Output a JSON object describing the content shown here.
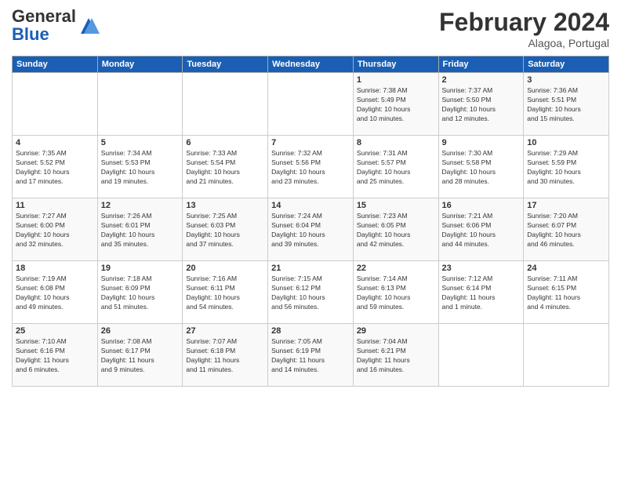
{
  "header": {
    "logo_text_general": "General",
    "logo_text_blue": "Blue",
    "title": "February 2024",
    "subtitle": "Alagoa, Portugal"
  },
  "days_of_week": [
    "Sunday",
    "Monday",
    "Tuesday",
    "Wednesday",
    "Thursday",
    "Friday",
    "Saturday"
  ],
  "weeks": [
    [
      {
        "day": "",
        "info": ""
      },
      {
        "day": "",
        "info": ""
      },
      {
        "day": "",
        "info": ""
      },
      {
        "day": "",
        "info": ""
      },
      {
        "day": "1",
        "info": "Sunrise: 7:38 AM\nSunset: 5:49 PM\nDaylight: 10 hours\nand 10 minutes."
      },
      {
        "day": "2",
        "info": "Sunrise: 7:37 AM\nSunset: 5:50 PM\nDaylight: 10 hours\nand 12 minutes."
      },
      {
        "day": "3",
        "info": "Sunrise: 7:36 AM\nSunset: 5:51 PM\nDaylight: 10 hours\nand 15 minutes."
      }
    ],
    [
      {
        "day": "4",
        "info": "Sunrise: 7:35 AM\nSunset: 5:52 PM\nDaylight: 10 hours\nand 17 minutes."
      },
      {
        "day": "5",
        "info": "Sunrise: 7:34 AM\nSunset: 5:53 PM\nDaylight: 10 hours\nand 19 minutes."
      },
      {
        "day": "6",
        "info": "Sunrise: 7:33 AM\nSunset: 5:54 PM\nDaylight: 10 hours\nand 21 minutes."
      },
      {
        "day": "7",
        "info": "Sunrise: 7:32 AM\nSunset: 5:56 PM\nDaylight: 10 hours\nand 23 minutes."
      },
      {
        "day": "8",
        "info": "Sunrise: 7:31 AM\nSunset: 5:57 PM\nDaylight: 10 hours\nand 25 minutes."
      },
      {
        "day": "9",
        "info": "Sunrise: 7:30 AM\nSunset: 5:58 PM\nDaylight: 10 hours\nand 28 minutes."
      },
      {
        "day": "10",
        "info": "Sunrise: 7:29 AM\nSunset: 5:59 PM\nDaylight: 10 hours\nand 30 minutes."
      }
    ],
    [
      {
        "day": "11",
        "info": "Sunrise: 7:27 AM\nSunset: 6:00 PM\nDaylight: 10 hours\nand 32 minutes."
      },
      {
        "day": "12",
        "info": "Sunrise: 7:26 AM\nSunset: 6:01 PM\nDaylight: 10 hours\nand 35 minutes."
      },
      {
        "day": "13",
        "info": "Sunrise: 7:25 AM\nSunset: 6:03 PM\nDaylight: 10 hours\nand 37 minutes."
      },
      {
        "day": "14",
        "info": "Sunrise: 7:24 AM\nSunset: 6:04 PM\nDaylight: 10 hours\nand 39 minutes."
      },
      {
        "day": "15",
        "info": "Sunrise: 7:23 AM\nSunset: 6:05 PM\nDaylight: 10 hours\nand 42 minutes."
      },
      {
        "day": "16",
        "info": "Sunrise: 7:21 AM\nSunset: 6:06 PM\nDaylight: 10 hours\nand 44 minutes."
      },
      {
        "day": "17",
        "info": "Sunrise: 7:20 AM\nSunset: 6:07 PM\nDaylight: 10 hours\nand 46 minutes."
      }
    ],
    [
      {
        "day": "18",
        "info": "Sunrise: 7:19 AM\nSunset: 6:08 PM\nDaylight: 10 hours\nand 49 minutes."
      },
      {
        "day": "19",
        "info": "Sunrise: 7:18 AM\nSunset: 6:09 PM\nDaylight: 10 hours\nand 51 minutes."
      },
      {
        "day": "20",
        "info": "Sunrise: 7:16 AM\nSunset: 6:11 PM\nDaylight: 10 hours\nand 54 minutes."
      },
      {
        "day": "21",
        "info": "Sunrise: 7:15 AM\nSunset: 6:12 PM\nDaylight: 10 hours\nand 56 minutes."
      },
      {
        "day": "22",
        "info": "Sunrise: 7:14 AM\nSunset: 6:13 PM\nDaylight: 10 hours\nand 59 minutes."
      },
      {
        "day": "23",
        "info": "Sunrise: 7:12 AM\nSunset: 6:14 PM\nDaylight: 11 hours\nand 1 minute."
      },
      {
        "day": "24",
        "info": "Sunrise: 7:11 AM\nSunset: 6:15 PM\nDaylight: 11 hours\nand 4 minutes."
      }
    ],
    [
      {
        "day": "25",
        "info": "Sunrise: 7:10 AM\nSunset: 6:16 PM\nDaylight: 11 hours\nand 6 minutes."
      },
      {
        "day": "26",
        "info": "Sunrise: 7:08 AM\nSunset: 6:17 PM\nDaylight: 11 hours\nand 9 minutes."
      },
      {
        "day": "27",
        "info": "Sunrise: 7:07 AM\nSunset: 6:18 PM\nDaylight: 11 hours\nand 11 minutes."
      },
      {
        "day": "28",
        "info": "Sunrise: 7:05 AM\nSunset: 6:19 PM\nDaylight: 11 hours\nand 14 minutes."
      },
      {
        "day": "29",
        "info": "Sunrise: 7:04 AM\nSunset: 6:21 PM\nDaylight: 11 hours\nand 16 minutes."
      },
      {
        "day": "",
        "info": ""
      },
      {
        "day": "",
        "info": ""
      }
    ]
  ]
}
